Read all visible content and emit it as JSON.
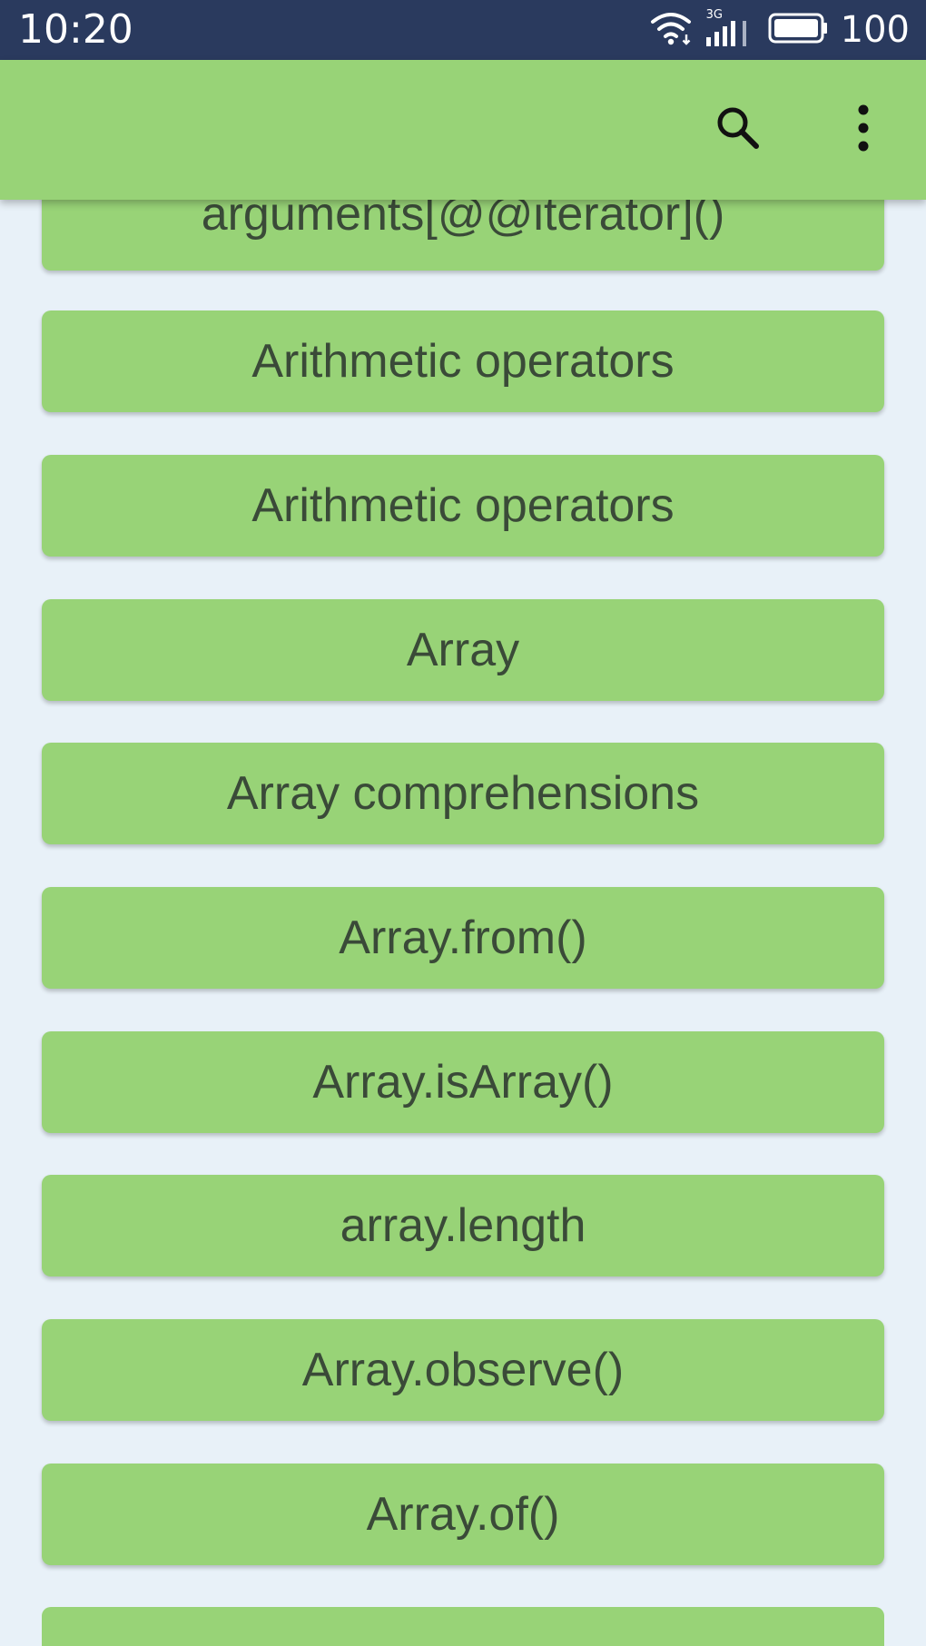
{
  "status_bar": {
    "time": "10:20",
    "network": "3G",
    "battery": "100",
    "icons": [
      "wifi-icon",
      "signal-icon",
      "battery-icon"
    ]
  },
  "toolbar": {
    "search_icon": "search-icon",
    "menu_icon": "more-vertical-icon"
  },
  "list": {
    "items": [
      {
        "label": "arguments[@@iterator]()"
      },
      {
        "label": "Arithmetic operators"
      },
      {
        "label": "Arithmetic operators"
      },
      {
        "label": "Array"
      },
      {
        "label": "Array comprehensions"
      },
      {
        "label": "Array.from()"
      },
      {
        "label": "Array.isArray()"
      },
      {
        "label": "array.length"
      },
      {
        "label": "Array.observe()"
      },
      {
        "label": "Array.of()"
      },
      {
        "label": ""
      }
    ]
  },
  "colors": {
    "status_bar": "#2a3a5e",
    "app_bar": "#98d377",
    "item_bg": "#98d377",
    "page_bg": "#e8f1f8",
    "item_text": "#3a4a38"
  }
}
